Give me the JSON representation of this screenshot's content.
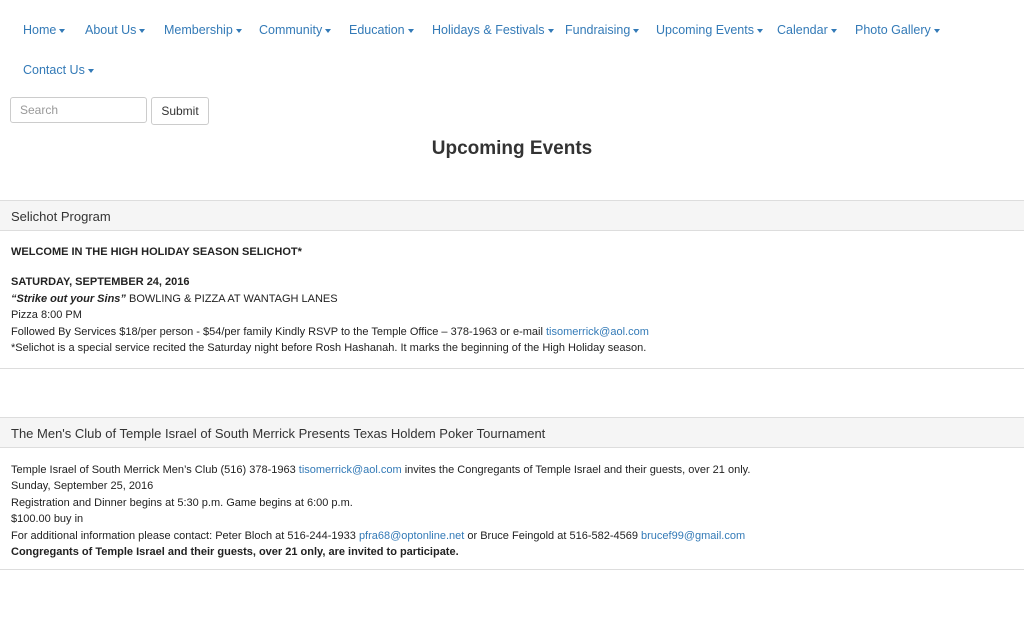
{
  "nav": {
    "items": [
      {
        "label": "Home"
      },
      {
        "label": "About Us"
      },
      {
        "label": "Membership"
      },
      {
        "label": "Community"
      },
      {
        "label": "Education"
      },
      {
        "label": "Holidays & Festivals"
      },
      {
        "label": "Fundraising"
      },
      {
        "label": "Upcoming Events"
      },
      {
        "label": "Calendar"
      },
      {
        "label": "Photo Gallery"
      },
      {
        "label": "Contact Us"
      }
    ],
    "caret_icon": "caret-down-icon"
  },
  "search": {
    "placeholder": "Search",
    "value": "",
    "submit_label": "Submit"
  },
  "page": {
    "title": "Upcoming Events"
  },
  "events": [
    {
      "heading": "Selichot Program",
      "welcome": "WELCOME IN THE HIGH HOLIDAY SEASON SELICHOT*",
      "date": "SATURDAY, SEPTEMBER 24, 2016",
      "tagline": "“Strike out your Sins”",
      "tagline_rest": " BOWLING & PIZZA AT WANTAGH LANES",
      "pizza_time": "Pizza 8:00 PM",
      "services_text": "Followed By Services $18/per person - $54/per family Kindly RSVP to the Temple Office – 378-1963 or e-mail ",
      "services_email": "tisomerrick@aol.com",
      "footnote": "*Selichot is a special service recited the Saturday night before Rosh Hashanah. It marks the beginning of the High Holiday season."
    },
    {
      "heading": "The Men's Club of Temple Israel of South Merrick Presents Texas Holdem Poker Tournament",
      "intro_text": "Temple Israel of South Merrick Men’s Club (516) 378-1963 ",
      "intro_email": "tisomerrick@aol.com",
      "intro_rest": " invites the Congregants of Temple Israel and their guests, over 21 only.",
      "date": "Sunday, September 25, 2016",
      "schedule": "Registration and Dinner begins at 5:30 p.m. Game begins at 6:00 p.m.",
      "buyin": "$100.00 buy in",
      "contact_text": "For additional information please contact: Peter Bloch at 516-244-1933 ",
      "contact_email_1": "pfra68@optonline.net",
      "contact_mid": " or Bruce Feingold at 516-582-4569 ",
      "contact_email_2": "brucef99@gmail.com",
      "closing": "Congregants of Temple Israel and their guests, over 21 only, are invited to participate."
    }
  ],
  "colors": {
    "link": "#337ab7",
    "panel_heading_bg": "#f5f5f5",
    "border": "#dddddd",
    "text": "#222222"
  }
}
